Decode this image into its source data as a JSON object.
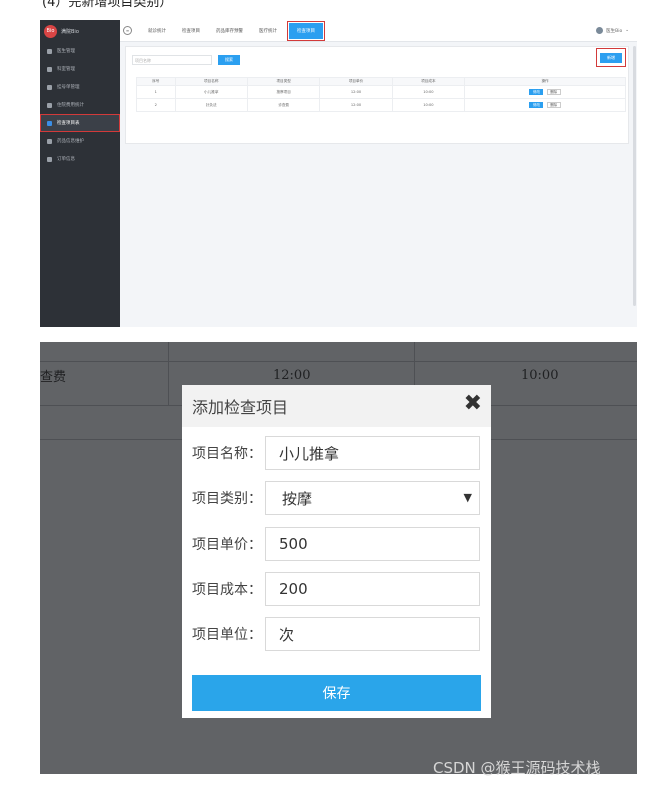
{
  "caption": "(4）完新增项目类别）",
  "shot1": {
    "brand_name": "满院Bio",
    "sidebar": [
      {
        "label": "医生管理",
        "active": false
      },
      {
        "label": "科室管理",
        "active": false
      },
      {
        "label": "挂号单管理",
        "active": false
      },
      {
        "label": "住院费用统计",
        "active": false
      },
      {
        "label": "检查项目表",
        "active": true
      },
      {
        "label": "药品信息维护",
        "active": false
      },
      {
        "label": "订单信息",
        "active": false
      }
    ],
    "nav_tabs": [
      {
        "label": "就诊统计",
        "active": false
      },
      {
        "label": "检查项目",
        "active": false
      },
      {
        "label": "药品库存预警",
        "active": false
      },
      {
        "label": "医疗统计",
        "active": false
      },
      {
        "label": "检查项目",
        "active": true
      }
    ],
    "user_name": "医生Bio",
    "search_placeholder": "项目名称",
    "search_label": "搜索",
    "add_label": "新增",
    "table": {
      "headers": [
        "序号",
        "项目名称",
        "项目类型",
        "项目单价",
        "项目成本",
        "操作"
      ],
      "rows": [
        [
          "1",
          "小儿推拿",
          "按摩项目",
          "12:00",
          "10:00"
        ],
        [
          "2",
          "针灸法",
          "诊查费",
          "12:00",
          "10:00"
        ]
      ],
      "edit_label": "修改",
      "delete_label": "删除"
    }
  },
  "shot2": {
    "bg_cell_left": "查费",
    "bg_cell_price": "12:00",
    "bg_cell_cost": "10:00",
    "modal": {
      "title": "添加检查项目",
      "fields": [
        {
          "label": "项目名称：",
          "value": "小儿推拿"
        },
        {
          "label": "项目类别：",
          "value": "按摩"
        },
        {
          "label": "项目单价：",
          "value": "500"
        },
        {
          "label": "项目成本：",
          "value": "200"
        },
        {
          "label": "项目单位：",
          "value": "次"
        }
      ],
      "save_label": "保存"
    }
  },
  "watermark": "CSDN @猴王源码技术栈"
}
